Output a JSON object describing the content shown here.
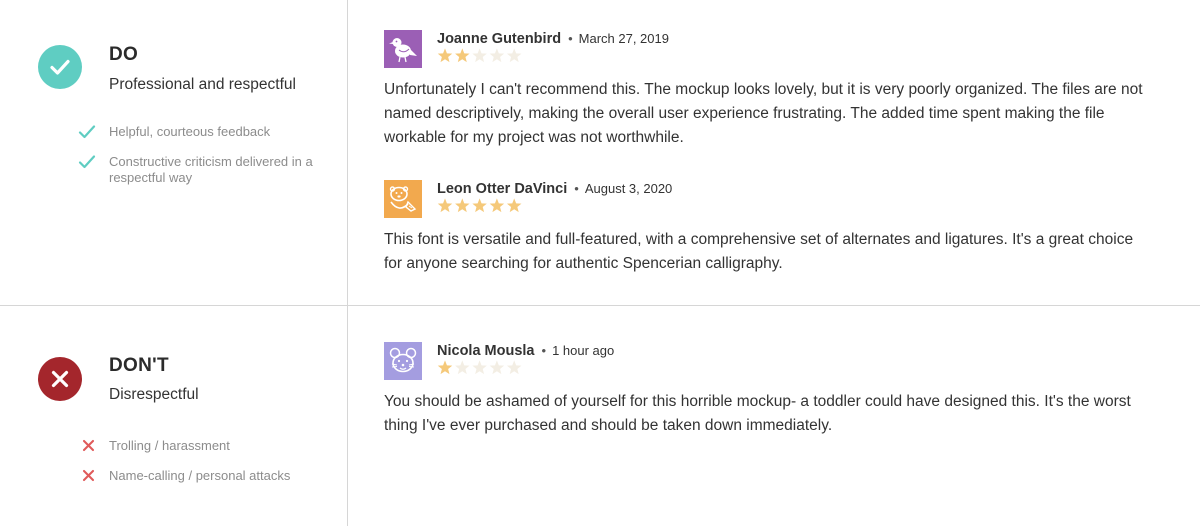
{
  "do": {
    "heading": "DO",
    "subheading": "Professional and respectful",
    "icon": "check-circle-icon",
    "color": "#5fcdc2",
    "bullets": [
      {
        "text": "Helpful, courteous feedback",
        "icon": "check-icon"
      },
      {
        "text": "Constructive criticism delivered in a respectful way",
        "icon": "check-icon"
      }
    ],
    "reviews": [
      {
        "author": "Joanne Gutenbird",
        "date": "March 27, 2019",
        "rating": 2,
        "avatar": "bird-avatar-icon",
        "avatar_color": "#9b5fb5",
        "text": "Unfortunately I can't recommend this. The mockup looks lovely, but it is very poorly organized. The files are not named descriptively, making the overall user experience frustrating. The added time spent making the file workable for my project was not worthwhile."
      },
      {
        "author": "Leon Otter DaVinci",
        "date": "August 3, 2020",
        "rating": 5,
        "avatar": "otter-avatar-icon",
        "avatar_color": "#f2a94e",
        "text": "This font is versatile and full-featured, with a comprehensive set of alternates and ligatures. It's a great choice for anyone searching for authentic Spencerian calligraphy."
      }
    ]
  },
  "dont": {
    "heading": "DON'T",
    "subheading": "Disrespectful",
    "icon": "x-circle-icon",
    "color": "#a4262c",
    "bullets": [
      {
        "text": "Trolling / harassment",
        "icon": "x-icon"
      },
      {
        "text": "Name-calling / personal attacks",
        "icon": "x-icon"
      }
    ],
    "reviews": [
      {
        "author": "Nicola Mousla",
        "date": "1 hour ago",
        "rating": 1,
        "avatar": "mouse-avatar-icon",
        "avatar_color": "#a49de0",
        "text": "You should be ashamed of yourself for this horrible mockup- a toddler could have designed this. It's the worst thing I've ever purchased and should be taken down immediately."
      }
    ]
  },
  "colors": {
    "star_filled": "#f5c97a",
    "star_empty": "#f3eee4",
    "bullet_check": "#5fcdc2",
    "bullet_x": "#e05a5a",
    "divider": "#d6d6d6"
  }
}
